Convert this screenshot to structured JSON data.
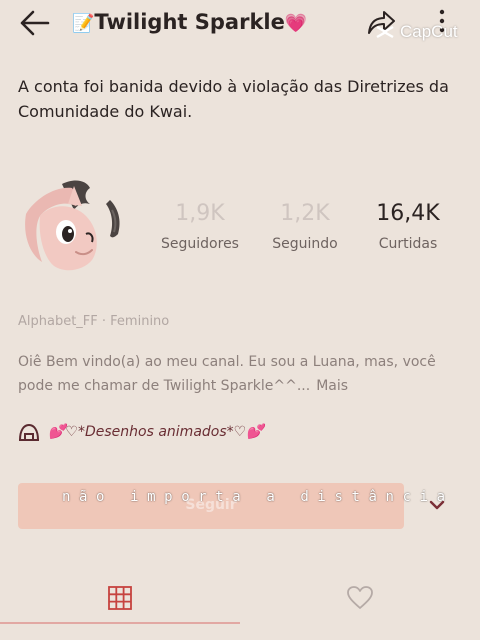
{
  "header": {
    "title_emoji": "📝",
    "title": "Twilight Sparkle",
    "title_suffix_emoji": "💗",
    "watermark": "CapCut"
  },
  "notice": {
    "text": "A conta foi banida devido à violação das Diretrizes da Comunidade do Kwai."
  },
  "stats": [
    {
      "value": "1,9K",
      "label": "Seguidores"
    },
    {
      "value": "1,2K",
      "label": "Seguindo"
    },
    {
      "value": "16,4K",
      "label": "Curtidas"
    }
  ],
  "profile": {
    "meta": "Alphabet_FF · Feminino",
    "bio": "Oiê Bem vindo(a) ao meu canal. Eu sou a Luana, mas, você pode me chamar de Twilight Sparkle^^...",
    "more_label": "Mais",
    "link_label": "💕♡*Desenhos animados*♡💕"
  },
  "follow_button": {
    "label": "Seguir",
    "overlay_text": "não importa a distância"
  },
  "colors": {
    "background": "#ece3db",
    "accent": "#efc7b8",
    "tab_indicator": "#e2a8a3"
  }
}
